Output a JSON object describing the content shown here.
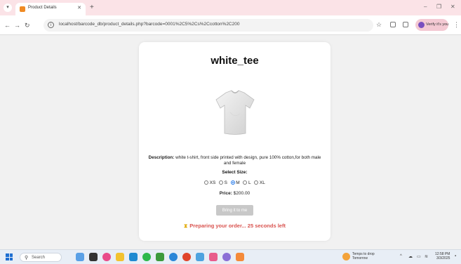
{
  "browser": {
    "tab_title": "Product Details",
    "url": "localhost/barcode_db/product_details.php?barcode=0001%2C5%2Cs%2Ccotton%2C200",
    "profile_label": "Verify it's you"
  },
  "product": {
    "title": "white_tee",
    "description_label": "Description:",
    "description_text": " white t-shirt, front side printed with design, pure 100% cotton,for both male and female",
    "size_label": "Select Size:",
    "sizes": [
      {
        "label": "XS",
        "selected": false
      },
      {
        "label": "S",
        "selected": false
      },
      {
        "label": "M",
        "selected": true
      },
      {
        "label": "L",
        "selected": false
      },
      {
        "label": "XL",
        "selected": false
      }
    ],
    "price_label": "Price:",
    "price_value": " $200.00",
    "button_label": "Bring it to me",
    "status_text": "Preparing your order... 25 seconds left",
    "status_icon": "hourglass-icon"
  },
  "taskbar": {
    "search_label": "Search",
    "weather_line1": "Temps to drop",
    "weather_line2": "Tomorrow",
    "clock_time": "12:58 PM",
    "clock_date": "3/3/2025"
  },
  "colors": {
    "tab_strip": "#fbe3e7",
    "status_red": "#d9534f",
    "button_disabled": "#c8c8c8",
    "radio_selected": "#1a73e8"
  }
}
